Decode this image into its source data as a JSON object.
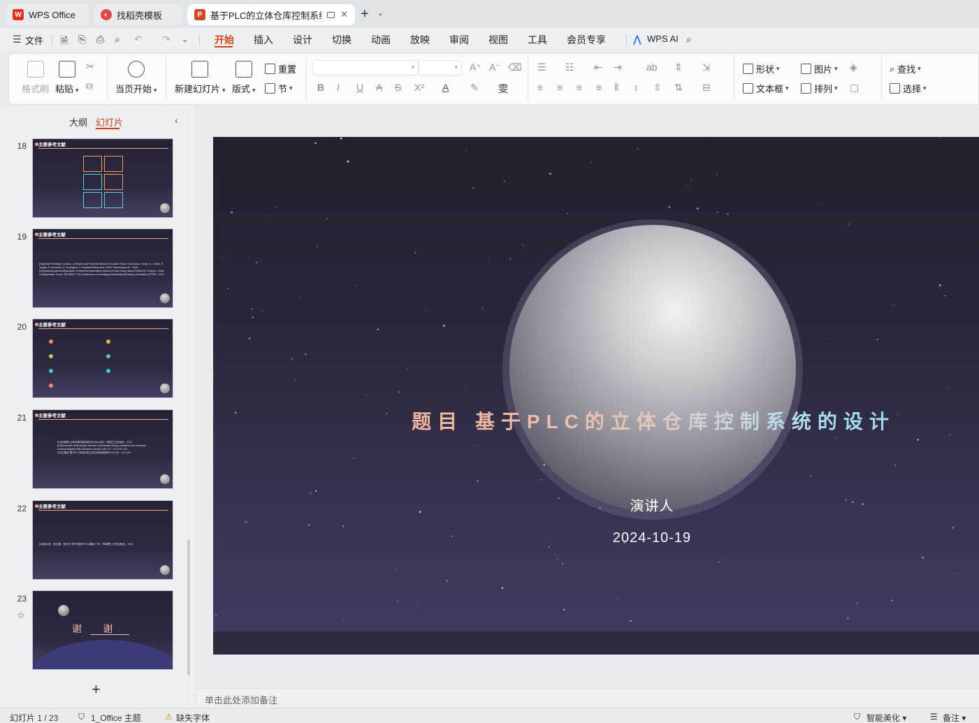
{
  "tabs": [
    {
      "label": "WPS Office",
      "icon": "wps-logo-icon",
      "color": "#e0321e"
    },
    {
      "label": "找稻壳模板",
      "icon": "docer-icon",
      "color": "#e24a4a"
    },
    {
      "label": "基于PLC的立体仓库控制系统的",
      "icon": "ppt-icon",
      "color": "#d24726"
    }
  ],
  "menu": {
    "file": "文件",
    "items": [
      "开始",
      "插入",
      "设计",
      "切换",
      "动画",
      "放映",
      "审阅",
      "视图",
      "工具",
      "会员专享"
    ],
    "active": "开始",
    "ai": "WPS AI"
  },
  "ribbon": {
    "format_painter": "格式刷",
    "paste": "粘贴",
    "play_from_current": "当页开始",
    "new_slide": "新建幻灯片",
    "layout": "版式",
    "section": "节",
    "reset": "重置",
    "shape": "形状",
    "picture": "图片",
    "textbox": "文本框",
    "arrange": "排列",
    "find": "查找",
    "select": "选择"
  },
  "left_panel": {
    "tab_outline": "大纲",
    "tab_slides": "幻灯片",
    "slide_title_text": "主要参考文献",
    "slides": [
      {
        "num": "18"
      },
      {
        "num": "19",
        "body": "[19]Model Predictive Control—A Simple and Powerful Method to Control Power Converters. Kouro, S, Cortes, P, Vargas, R, Ammann, U, Rodriguez, J. Industrial Electronics, IEEE Transactions on . 2009\n[20]Towards autoreconfiguration of industrial automation systems A case study using Profinet IO. Dürkop L,Trsek H,Jasperneite J,et al. 2012IEEE 17th Conference on Emerging Technologies&Factory Automation (ETFA) . 2012"
      },
      {
        "num": "20"
      },
      {
        "num": "21",
        "body": "[21]刘新国.立体仓库控制系统设计[M].北京：机械工业出版社，2012.\n[22]Automatic stereoscopic elevator mechanical design principles and concepts. London:England Ellis Horwood Limited,1987:117~121,124~131\n[23]王国庆.基于PLC的自动化立体仓库系统研究.2011(3)：141-142."
      },
      {
        "num": "22",
        "body": "[24]胡立成、徐玉春、徐月才.电气控制与PLC编程.广州：华南理工大学出版社，2010."
      },
      {
        "num": "23",
        "thanks": "谢      谢"
      }
    ]
  },
  "slide": {
    "title": "题目  基于PLC的立体仓库控制系统的设计",
    "presenter": "演讲人",
    "date": "2024-10-19"
  },
  "notes_placeholder": "单击此处添加备注",
  "status": {
    "slide_counter": "幻灯片 1 / 23",
    "theme": "1_Office 主题",
    "missing_font": "缺失字体",
    "smart_beautify": "智能美化",
    "notes": "备注"
  }
}
